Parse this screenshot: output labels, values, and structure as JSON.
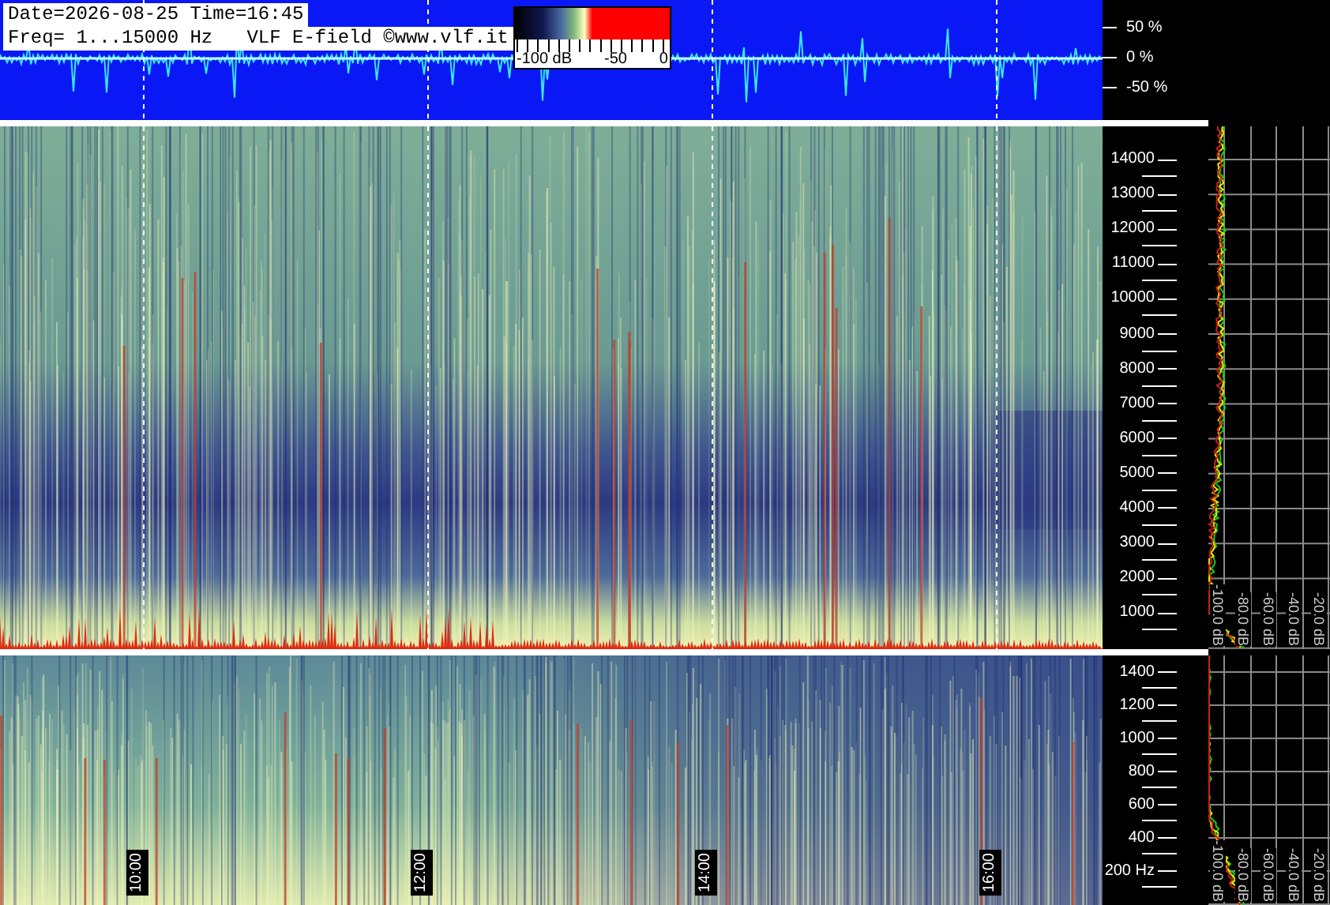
{
  "header": {
    "date_time": "Date=2026-08-25 Time=16:45",
    "info": "Freq= 1...15000 Hz   VLF E-field ©www.vlf.it"
  },
  "color_scale": {
    "labels": [
      "-100 dB",
      "-50",
      "0"
    ]
  },
  "waveform": {
    "percent_labels": [
      "50 %",
      "0 %",
      "-50 %"
    ]
  },
  "upper_panel": {
    "freq_labels": [
      "14000",
      "13000",
      "12000",
      "11000",
      "10000",
      "9000",
      "8000",
      "7000",
      "6000",
      "5000",
      "4000",
      "3000",
      "2000",
      "1000"
    ],
    "db_labels": [
      "-100.0 dB",
      "-80.0 dB",
      "-60.0 dB",
      "-40.0 dB",
      "-20.0 dB"
    ]
  },
  "lower_panel": {
    "freq_labels": [
      "1400",
      "1200",
      "1000",
      "800",
      "600",
      "400",
      "200 Hz"
    ],
    "db_labels": [
      "-100.0 dB",
      "-80.0 dB",
      "-60.0 dB",
      "-40.0 dB",
      "-20.0 dB"
    ]
  },
  "time_labels": [
    "10:00",
    "12:00",
    "14:00",
    "16:00"
  ]
}
